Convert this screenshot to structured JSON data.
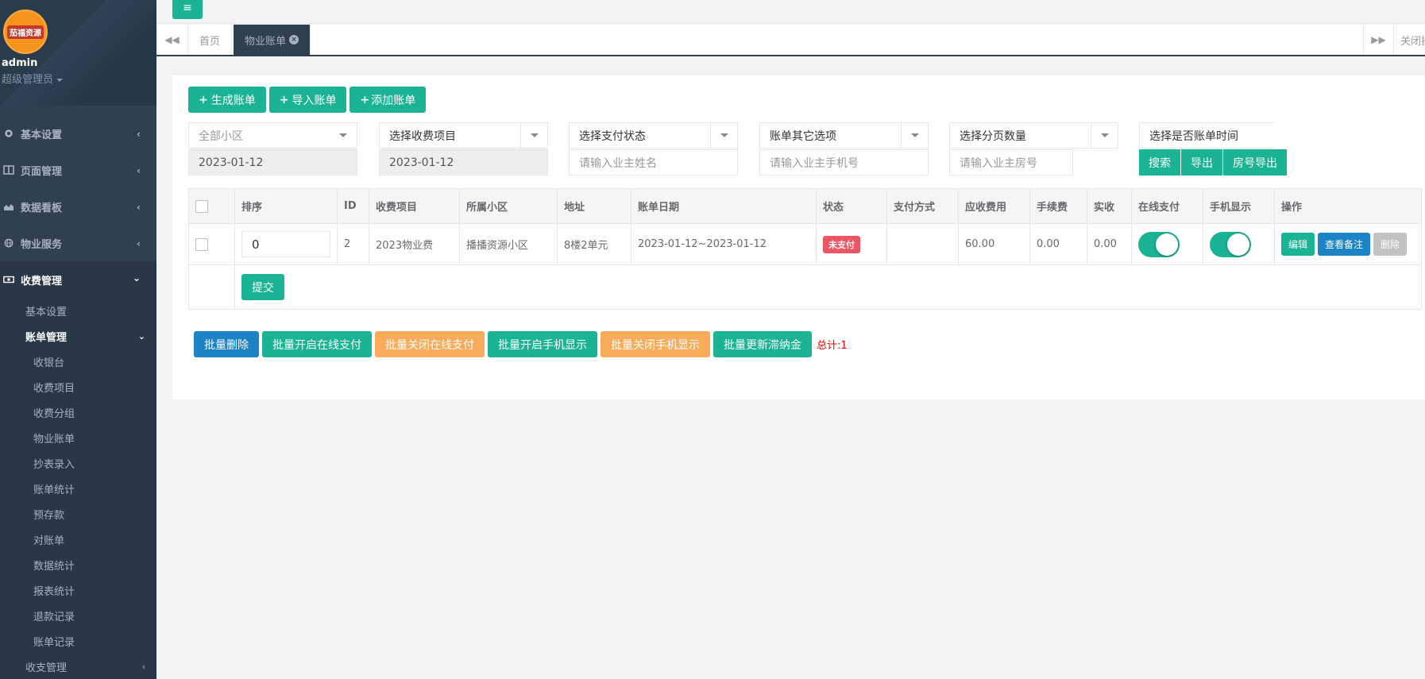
{
  "logo": {
    "text": "茄福资源"
  },
  "profile": {
    "name": "admin",
    "role": "超级管理员"
  },
  "sidebar": {
    "items": [
      {
        "label": "基本设置",
        "icon": "gear-icon"
      },
      {
        "label": "页面管理",
        "icon": "columns-icon"
      },
      {
        "label": "数据看板",
        "icon": "area-chart-icon"
      },
      {
        "label": "物业服务",
        "icon": "globe-icon"
      },
      {
        "label": "收费管理",
        "icon": "money-icon"
      }
    ],
    "sub": {
      "basic": "基本设置",
      "bills": "账单管理",
      "leaves": [
        "收银台",
        "收费项目",
        "收费分组",
        "物业账单",
        "抄表录入",
        "账单统计",
        "预存款",
        "对账单",
        "数据统计",
        "报表统计",
        "退款记录",
        "账单记录"
      ],
      "next": "收支管理"
    }
  },
  "tabs": {
    "home": "首页",
    "active": "物业账单",
    "close_all": "关闭操作"
  },
  "toolbar": {
    "generate": "生成账单",
    "import": "导入账单",
    "add": "添加账单"
  },
  "filters": {
    "community": "全部小区",
    "charge_item": "选择收费项目",
    "pay_status": "选择支付状态",
    "other": "账单其它选项",
    "page_size": "选择分页数量",
    "bill_time": "选择是否账单时间",
    "date_from": "2023-01-12",
    "date_to": "2023-01-12",
    "owner_name_placeholder": "请输入业主姓名",
    "owner_phone_placeholder": "请输入业主手机号",
    "room_placeholder": "请输入业主房号",
    "search": "搜索",
    "export": "导出",
    "room_export": "房号导出"
  },
  "table": {
    "headers": [
      "排序",
      "ID",
      "收费项目",
      "所属小区",
      "地址",
      "账单日期",
      "状态",
      "支付方式",
      "应收费用",
      "手续费",
      "实收",
      "在线支付",
      "手机显示",
      "操作"
    ],
    "rows": [
      {
        "sort": "0",
        "id": "2",
        "item": "2023物业费",
        "community": "播播资源小区",
        "address": "8楼2单元",
        "date": "2023-01-12~2023-01-12",
        "status": "未支付",
        "pay_method": "",
        "receivable": "60.00",
        "fee": "0.00",
        "received": "0.00",
        "online_pay": true,
        "mobile_show": true,
        "ops": {
          "edit": "编辑",
          "note": "查看备注",
          "delete": "删除"
        }
      }
    ],
    "submit": "提交"
  },
  "batch": {
    "delete": "批量删除",
    "open_online": "批量开启在线支付",
    "close_online": "批量关闭在线支付",
    "open_mobile": "批量开启手机显示",
    "close_mobile": "批量关闭手机显示",
    "update_late": "批量更新滞纳金",
    "total": "总计:1"
  },
  "colors": {
    "primary": "#1ab394",
    "info": "#1c84c6",
    "warning": "#f8ac59",
    "danger": "#ed5565",
    "sidebar": "#2f4050"
  }
}
